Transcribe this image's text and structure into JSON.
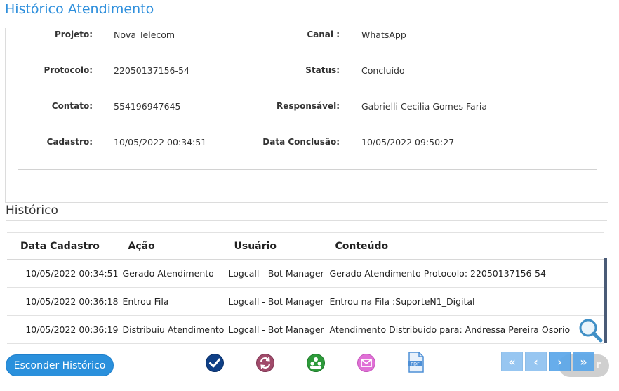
{
  "header": {
    "title": "Histórico Atendimento"
  },
  "details": {
    "projeto_label": "Projeto:",
    "projeto_value": "Nova Telecom",
    "canal_label": "Canal :",
    "canal_value": "WhatsApp",
    "protocolo_label": "Protocolo:",
    "protocolo_value": "22050137156-54",
    "status_label": "Status:",
    "status_value": "Concluído",
    "contato_label": "Contato:",
    "contato_value": "554196947645",
    "responsavel_label": "Responsável:",
    "responsavel_value": "Gabrielli Cecilia Gomes Faria",
    "cadastro_label": "Cadastro:",
    "cadastro_value": "10/05/2022 00:34:51",
    "conclusao_label": "Data Conclusão:",
    "conclusao_value": "10/05/2022 09:50:27"
  },
  "history": {
    "title": "Histórico",
    "columns": [
      "Data Cadastro",
      "Ação",
      "Usuário",
      "Conteúdo"
    ],
    "rows": [
      [
        "10/05/2022 00:34:51",
        "Gerado Atendimento",
        "Logcall - Bot Manager",
        "Gerado Atendimento Protocolo: 22050137156-54"
      ],
      [
        "10/05/2022 00:36:18",
        "Entrou Fila",
        "Logcall - Bot Manager",
        "Entrou na Fila :SuporteN1_Digital"
      ],
      [
        "10/05/2022 00:36:19",
        "Distribuiu Atendimento",
        "Logcall - Bot Manager",
        "Atendimento Distribuido para: Andressa Pereira Osorio"
      ]
    ]
  },
  "footer": {
    "hide_history_label": "Esconder Histórico",
    "ghost_button_text": "r",
    "pager": {
      "first": "«",
      "prev": "‹",
      "next": "›",
      "last": "»"
    },
    "tools": [
      "check-icon",
      "transfer-icon",
      "users-icon",
      "email-icon",
      "pdf-icon"
    ]
  },
  "colors": {
    "accent": "#2a90dc",
    "title": "#2e8fdc",
    "pager": "#5ba7ea"
  }
}
